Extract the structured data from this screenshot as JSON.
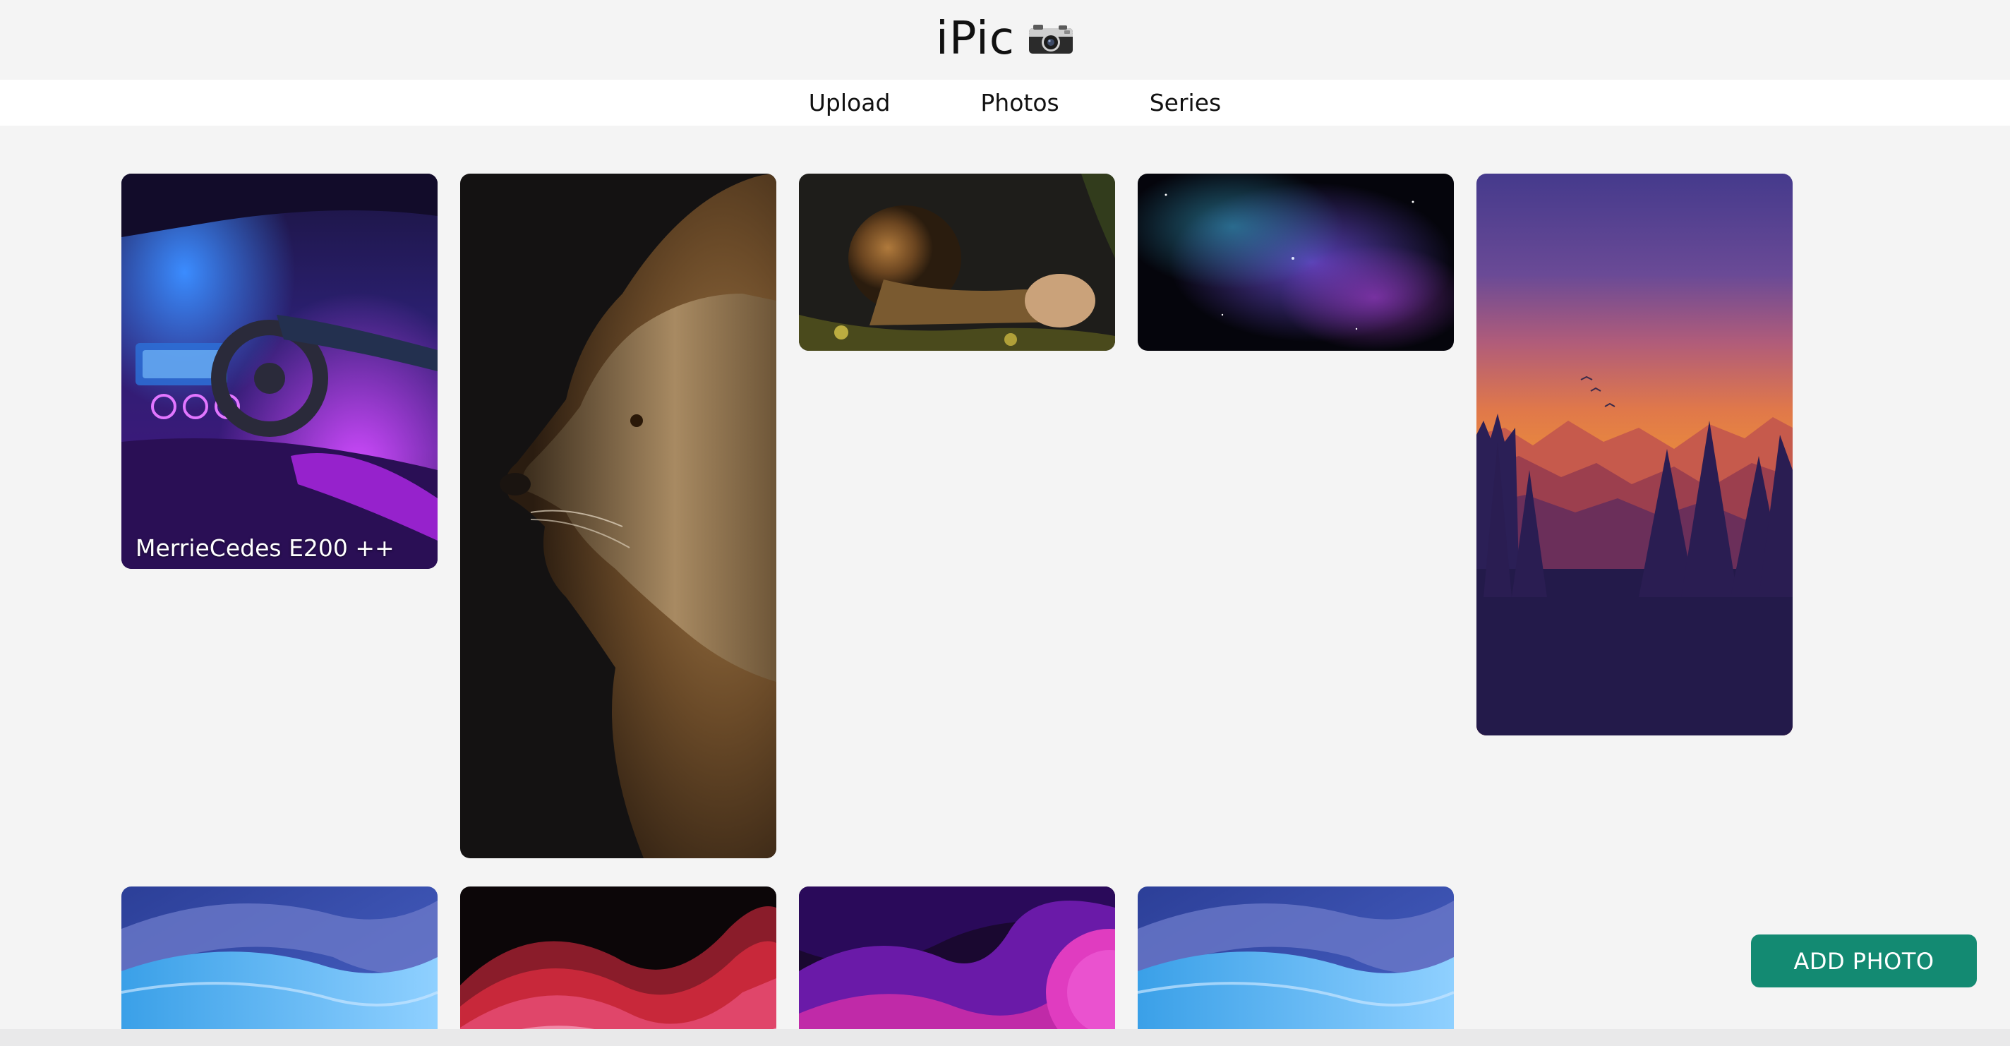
{
  "header": {
    "title": "iPic",
    "icon": "camera-icon"
  },
  "nav": {
    "items": [
      {
        "label": "Upload"
      },
      {
        "label": "Photos"
      },
      {
        "label": "Series"
      }
    ]
  },
  "gallery": {
    "cards": [
      {
        "caption": "MerrieCedes E200 ++",
        "subject": "car-interior"
      },
      {
        "caption": "",
        "subject": "lion-profile"
      },
      {
        "caption": "",
        "subject": "lion-lying"
      },
      {
        "caption": "",
        "subject": "nebula"
      },
      {
        "caption": "",
        "subject": "sunset-mountains"
      },
      {
        "caption": "",
        "subject": "blue-wave"
      },
      {
        "caption": "",
        "subject": "red-wave"
      },
      {
        "caption": "",
        "subject": "purple-abstract"
      },
      {
        "caption": "",
        "subject": "blue-wave"
      }
    ]
  },
  "actions": {
    "add_photo_label": "ADD PHOTO"
  },
  "colors": {
    "background": "#f4f4f4",
    "nav_background": "#ffffff",
    "accent": "#138a72"
  }
}
